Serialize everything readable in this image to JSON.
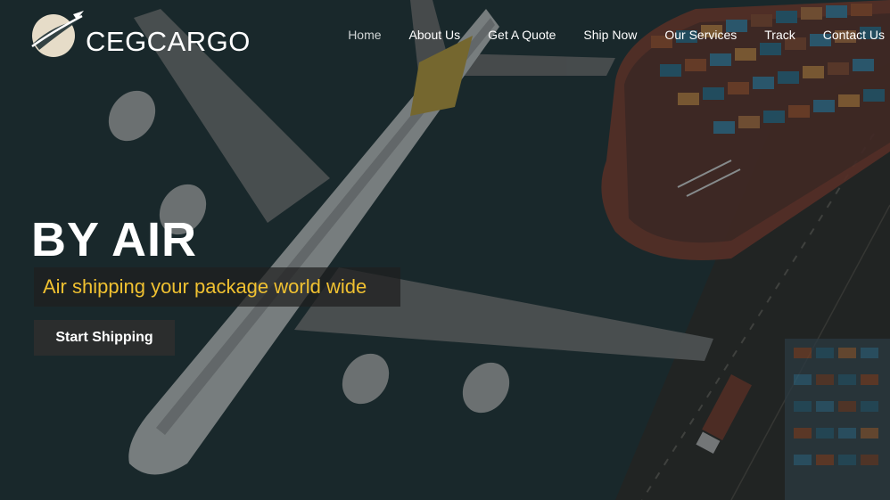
{
  "brand": {
    "name": "CEGCARGO"
  },
  "nav": {
    "items": [
      {
        "label": "Home",
        "active": true
      },
      {
        "label": "About Us"
      },
      {
        "label": "Get A Quote"
      },
      {
        "label": "Ship Now"
      },
      {
        "label": "Our Services"
      },
      {
        "label": "Track"
      },
      {
        "label": "Contact Us"
      }
    ]
  },
  "hero": {
    "title": "BY AIR",
    "tagline": "Air shipping your package world wide",
    "cta_label": "Start Shipping"
  },
  "colors": {
    "tagline": "#f0c131",
    "text": "#ffffff",
    "overlay": "#1d2a2c"
  }
}
